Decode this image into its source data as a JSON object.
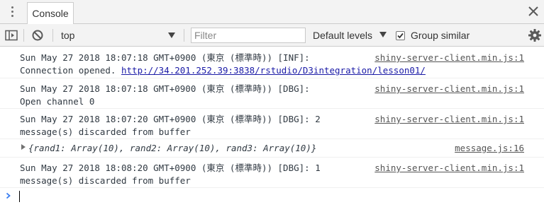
{
  "tabbar": {
    "menu_icon": "kebab-menu-icon",
    "tab_label": "Console",
    "close_icon": "close-icon"
  },
  "toolbar": {
    "sidebar_icon": "sidebar-toggle-icon",
    "clear_icon": "clear-console-icon",
    "context": "top",
    "filter_placeholder": "Filter",
    "filter_value": "",
    "levels_label": "Default levels",
    "group_similar_label": "Group similar",
    "group_similar_checked": true,
    "settings_icon": "gear-icon"
  },
  "messages": [
    {
      "line1": "Sun May 27 2018 18:07:18 GMT+0900 (東京 (標準時)) [INF]:",
      "line2_text": "Connection opened. ",
      "line2_link": "http://34.201.252.39:3838/rstudio/D3integration/lesson01/",
      "source": "shiny-server-client.min.js:1"
    },
    {
      "line1": "Sun May 27 2018 18:07:18 GMT+0900 (東京 (標準時)) [DBG]:",
      "line2_text": "Open channel 0",
      "source": "shiny-server-client.min.js:1"
    },
    {
      "line1": "Sun May 27 2018 18:07:20 GMT+0900 (東京 (標準時)) [DBG]: 2",
      "line2_text": "message(s) discarded from buffer",
      "source": "shiny-server-client.min.js:1"
    },
    {
      "object_preview": "{rand1: Array(10), rand2: Array(10), rand3: Array(10)}",
      "source": "message.js:16"
    },
    {
      "line1": "Sun May 27 2018 18:08:20 GMT+0900 (東京 (標準時)) [DBG]: 1",
      "line2_text": "message(s) discarded from buffer",
      "source": "shiny-server-client.min.js:1"
    }
  ],
  "prompt": {
    "icon": "prompt-chevron-icon",
    "value": ""
  },
  "colors": {
    "toolbar_bg": "#f3f3f3",
    "link": "#1a1aa6",
    "prompt": "#367cf1"
  }
}
